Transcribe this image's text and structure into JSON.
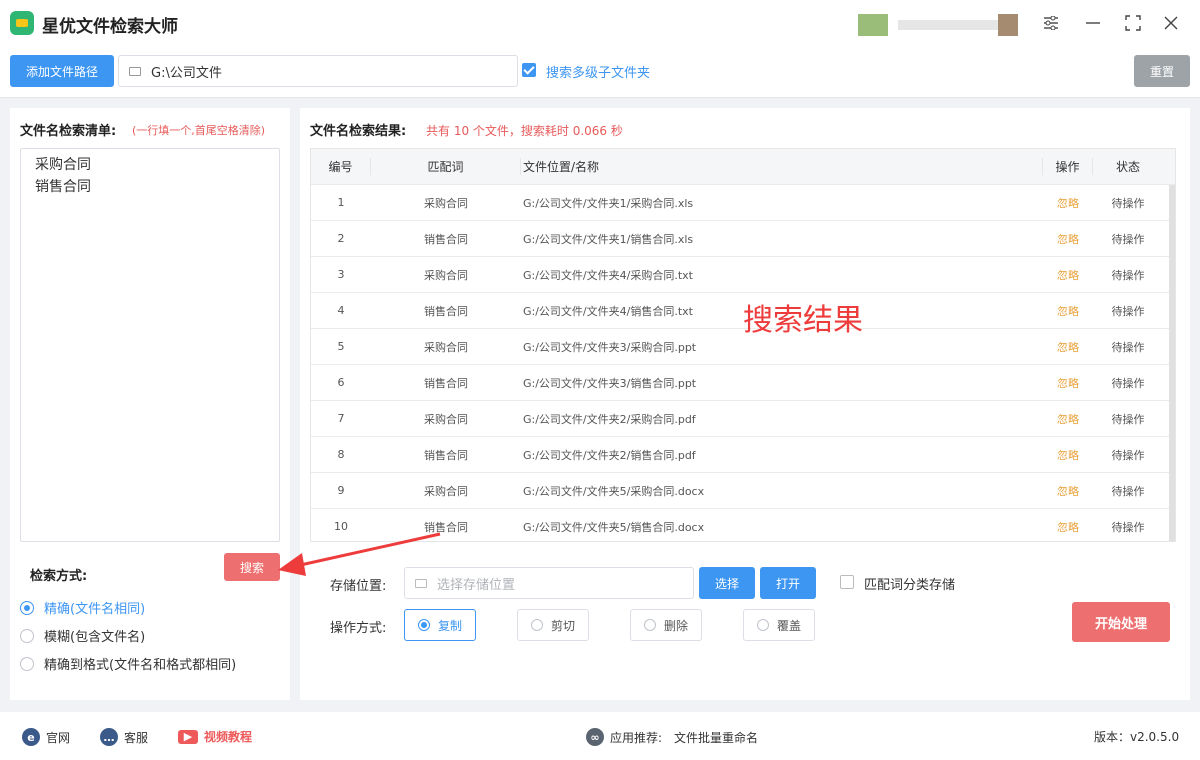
{
  "app": {
    "title": "星优文件检索大师"
  },
  "toolbar": {
    "add_path_label": "添加文件路径",
    "path_value": "G:\\公司文件",
    "subfolder_checked": true,
    "subfolder_label": "搜索多级子文件夹",
    "reset_label": "重置"
  },
  "left": {
    "list_title": "文件名检索清单:",
    "list_hint": "(一行填一个,首尾空格清除)",
    "names": [
      "采购合同",
      "销售合同"
    ],
    "search_label": "搜索",
    "mode_title": "检索方式:",
    "modes": [
      {
        "label": "精确(文件名相同)",
        "selected": true
      },
      {
        "label": "模糊(包含文件名)",
        "selected": false
      },
      {
        "label": "精确到格式(文件名和格式都相同)",
        "selected": false
      }
    ]
  },
  "results": {
    "title": "文件名检索结果:",
    "summary": "共有 10 个文件，搜索耗时 0.066 秒",
    "columns": [
      "编号",
      "匹配词",
      "文件位置/名称",
      "操作",
      "状态"
    ],
    "rows": [
      {
        "no": "1",
        "match": "采购合同",
        "path": "G:/公司文件/文件夹1/采购合同.xls",
        "op": "忽略",
        "status": "待操作"
      },
      {
        "no": "2",
        "match": "销售合同",
        "path": "G:/公司文件/文件夹1/销售合同.xls",
        "op": "忽略",
        "status": "待操作"
      },
      {
        "no": "3",
        "match": "采购合同",
        "path": "G:/公司文件/文件夹4/采购合同.txt",
        "op": "忽略",
        "status": "待操作"
      },
      {
        "no": "4",
        "match": "销售合同",
        "path": "G:/公司文件/文件夹4/销售合同.txt",
        "op": "忽略",
        "status": "待操作"
      },
      {
        "no": "5",
        "match": "采购合同",
        "path": "G:/公司文件/文件夹3/采购合同.ppt",
        "op": "忽略",
        "status": "待操作"
      },
      {
        "no": "6",
        "match": "销售合同",
        "path": "G:/公司文件/文件夹3/销售合同.ppt",
        "op": "忽略",
        "status": "待操作"
      },
      {
        "no": "7",
        "match": "采购合同",
        "path": "G:/公司文件/文件夹2/采购合同.pdf",
        "op": "忽略",
        "status": "待操作"
      },
      {
        "no": "8",
        "match": "销售合同",
        "path": "G:/公司文件/文件夹2/销售合同.pdf",
        "op": "忽略",
        "status": "待操作"
      },
      {
        "no": "9",
        "match": "采购合同",
        "path": "G:/公司文件/文件夹5/采购合同.docx",
        "op": "忽略",
        "status": "待操作"
      },
      {
        "no": "10",
        "match": "销售合同",
        "path": "G:/公司文件/文件夹5/销售合同.docx",
        "op": "忽略",
        "status": "待操作"
      }
    ],
    "overlay_label": "搜索结果"
  },
  "bottom": {
    "store_label": "存储位置:",
    "store_placeholder": "选择存储位置",
    "choose_label": "选择",
    "open_label": "打开",
    "classify_checked": false,
    "classify_label": "匹配词分类存储",
    "op_label": "操作方式:",
    "ops": [
      {
        "label": "复制",
        "selected": true
      },
      {
        "label": "剪切",
        "selected": false
      },
      {
        "label": "删除",
        "selected": false
      },
      {
        "label": "覆盖",
        "selected": false
      }
    ],
    "start_label": "开始处理"
  },
  "statusbar": {
    "website": "官网",
    "support": "客服",
    "video": "视频教程",
    "recommend_label": "应用推荐:",
    "recommend_app": "文件批量重命名",
    "version": "版本：v2.0.5.0"
  },
  "colors": {
    "primary": "#3d96f2",
    "danger": "#ee6f6f",
    "warning": "#e8a23c",
    "success": "#2fb673"
  }
}
